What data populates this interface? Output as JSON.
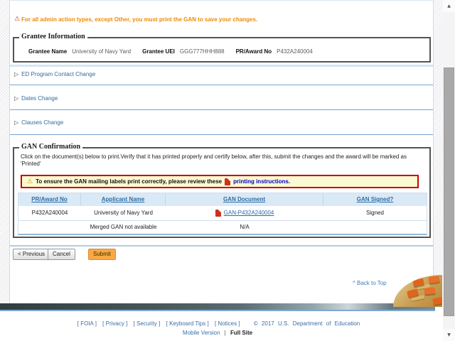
{
  "top_warning": {
    "icon": "⚠",
    "text": "For all admin action types, except Other, you must print the GAN to save your changes."
  },
  "grantee_info": {
    "legend": "Grantee Information",
    "fields": [
      {
        "label": "Grantee Name",
        "value": "University of Navy Yard"
      },
      {
        "label": "Grantee UEI",
        "value": "GGG777HHH888"
      },
      {
        "label": "PR/Award No",
        "value": "P432A240004"
      }
    ]
  },
  "sections": [
    {
      "icon": "▷",
      "label": "ED Program Contact Change"
    },
    {
      "icon": "▷",
      "label": "Dates Change"
    },
    {
      "icon": "▷",
      "label": "Clauses Change"
    }
  ],
  "gan_confirmation": {
    "legend": "GAN Confirmation",
    "description": "Click on the document(s) below to print.Verify that it has printed properly and certify below, after this, submit the changes and the award will be marked as 'Printed'",
    "alert": {
      "icon": "⚠",
      "text": "To ensure the GAN mailing labels print correctly, please review these",
      "link_label": "printing instructions."
    },
    "table": {
      "headers": [
        "PR/Award No",
        "Applicant Name",
        "GAN Document",
        "GAN Signed?"
      ],
      "rows": [
        {
          "pr_award_no": "P432A240004",
          "applicant_name": "University of Navy Yard",
          "gan_document": "GAN-P432A240004",
          "gan_signed": "Signed"
        },
        {
          "pr_award_no": "",
          "applicant_name": "Merged GAN not available",
          "gan_document": "N/A",
          "gan_signed": ""
        }
      ]
    }
  },
  "actions": {
    "previous": "< Previous",
    "cancel": "Cancel",
    "submit": "Submit"
  },
  "back_to_top": {
    "label": "^ Back to Top"
  },
  "footer": {
    "bracket_open": "[",
    "bracket_close": "]",
    "links": [
      {
        "label": "FOIA"
      },
      {
        "label": "Privacy"
      },
      {
        "label": "Security"
      },
      {
        "label": "Keyboard Tips"
      },
      {
        "label": "Notices"
      }
    ],
    "copyright": "© 2017 U.S. Department of Education",
    "mobile_version": "Mobile Version",
    "separator": "|",
    "full_site": "Full Site"
  },
  "scrollbar": {
    "up": "▲",
    "down": "▼"
  },
  "colors": {
    "warning_orange": "#ef8a00",
    "link_blue": "#336b9c",
    "alert_border_red": "#cc0000",
    "alert_bg_yellow": "#fafad2",
    "table_header_bg": "#d9e9f6",
    "submit_orange": "#f9a845",
    "rule_blue": "#aecde6"
  }
}
